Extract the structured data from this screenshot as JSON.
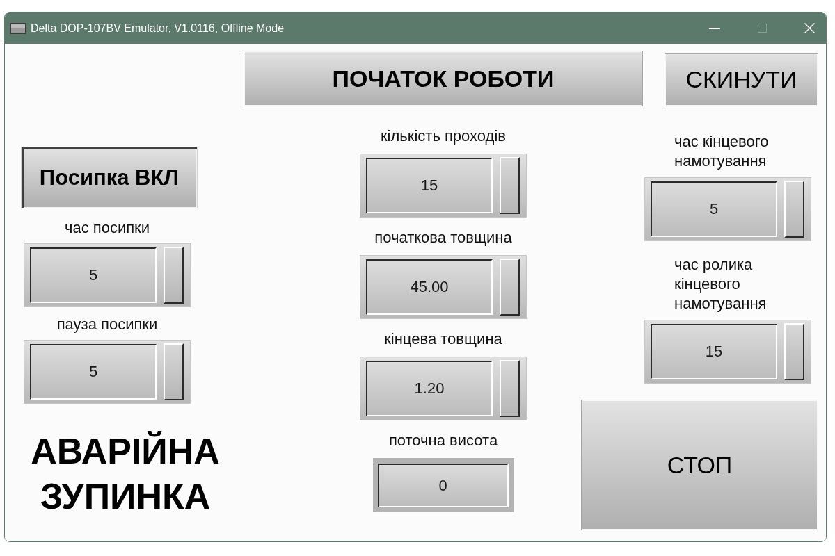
{
  "window": {
    "title": "Delta DOP-107BV Emulator, V1.0116, Offline Mode",
    "buttons": [
      {
        "kind": "minimize",
        "disabled": false
      },
      {
        "kind": "maximize",
        "disabled": true
      },
      {
        "kind": "close",
        "disabled": false
      }
    ]
  },
  "screen": {
    "feed_toggle": {
      "label": "Посипка ВКЛ",
      "pressed": true
    },
    "left_fields": [
      {
        "label": "час посипки",
        "value": "5",
        "kind": "input"
      },
      {
        "label": "пауза посипки",
        "value": "5",
        "kind": "input"
      }
    ],
    "emergency_text": "АВАРІЙНА\nЗУПИНКА",
    "start_button": {
      "label": "ПОЧАТОК РОБОТИ",
      "pressed": false
    },
    "center_fields": [
      {
        "label": "кількість проходів",
        "value": "15",
        "kind": "input"
      },
      {
        "label": "початкова товщина",
        "value": "45.00",
        "kind": "input"
      },
      {
        "label": "кінцева товщина",
        "value": "1.20",
        "kind": "input"
      },
      {
        "label": "поточна висота",
        "value": "0",
        "kind": "display"
      }
    ],
    "reset_button": {
      "label": "СКИНУТИ",
      "pressed": false
    },
    "right_fields": [
      {
        "label": "час кінцевого\nнамотування",
        "value": "5",
        "kind": "input"
      },
      {
        "label": "час ролика\nкінцевого\nнамотування",
        "value": "15",
        "kind": "input"
      }
    ],
    "stop_button": {
      "label": "СТОП",
      "pressed": false
    }
  }
}
